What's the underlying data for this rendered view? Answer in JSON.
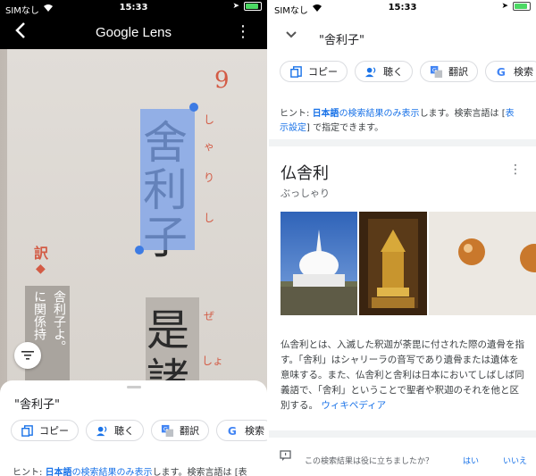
{
  "left_panel": {
    "status": {
      "carrier": "SIMなし",
      "time": "15:33"
    },
    "header": {
      "title": "Google Lens"
    },
    "page_text": {
      "selected": [
        "舍",
        "利",
        "子"
      ],
      "furigana": [
        "し",
        "ゃ",
        "り",
        "し"
      ],
      "page_number": "9",
      "second_column": [
        "是",
        "諸"
      ],
      "second_furigana": [
        "ぜ",
        "しょ"
      ],
      "side_label": "訳",
      "side_text": [
        "舎利子よ。",
        "に関係持"
      ]
    },
    "sheet": {
      "query": "\"舎利子\"",
      "chips": [
        {
          "label": "コピー",
          "icon": "copy-icon"
        },
        {
          "label": "聴く",
          "icon": "listen-icon"
        },
        {
          "label": "翻訳",
          "icon": "translate-icon"
        },
        {
          "label": "検索",
          "icon": "google-icon"
        }
      ],
      "hint_prefix": "ヒント: ",
      "hint_bold": "日本語",
      "hint_link": "の検索結果のみ表示",
      "hint_suffix": "します。検索言語は [表"
    }
  },
  "right_panel": {
    "status": {
      "carrier": "SIMなし",
      "time": "15:33"
    },
    "query": "\"舎利子\"",
    "chips": [
      {
        "label": "コピー",
        "icon": "copy-icon"
      },
      {
        "label": "聴く",
        "icon": "listen-icon"
      },
      {
        "label": "翻訳",
        "icon": "translate-icon"
      },
      {
        "label": "検索",
        "icon": "google-icon"
      }
    ],
    "hint": {
      "prefix": "ヒント: ",
      "bold": "日本語",
      "link": "の検索結果のみ表示",
      "middle": "します。検索言語は [",
      "link2": "表",
      "line2_link": "示設定",
      "line2_suffix": "] で指定できます。"
    },
    "entity": {
      "title": "仏舎利",
      "subtitle": "ぶっしゃり",
      "description": "仏舎利とは、入滅した釈迦が荼毘に付された際の遺骨を指す。「舎利」はシャリーラの音写であり遺骨または遺体を意味する。また、仏舎利と舎利は日本においてしばしば同義語で、「舎利」ということで聖者や釈迦のそれを他と区別する。",
      "wiki_link": "ウィキペディア"
    },
    "feedback": {
      "question": "この検索結果は役に立ちましたか？",
      "yes": "はい",
      "no": "いいえ"
    }
  }
}
